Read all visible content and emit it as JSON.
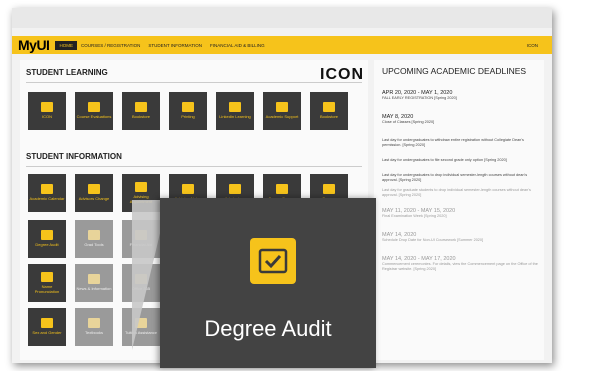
{
  "nav": {
    "logo": "MyUI",
    "items": [
      {
        "label": "HOME",
        "active": true
      },
      {
        "label": "COURSES / REGISTRATION",
        "active": false
      },
      {
        "label": "STUDENT INFORMATION",
        "active": false
      },
      {
        "label": "FINANCIAL AID & BILLING",
        "active": false
      }
    ],
    "right": "ICON",
    "accent": "#f6c31b"
  },
  "learning": {
    "title": "STUDENT LEARNING",
    "brand": "ICON",
    "tiles": [
      {
        "label": "ICON",
        "icon": "list-icon"
      },
      {
        "label": "Course Evaluations",
        "icon": "checkbox-icon"
      },
      {
        "label": "Bookstore",
        "icon": "book-icon"
      },
      {
        "label": "Printing",
        "icon": "printer-icon"
      },
      {
        "label": "Linkedin Learning",
        "icon": "monitor-icon"
      },
      {
        "label": "Academic Support",
        "icon": "building-icon"
      },
      {
        "label": "Bookstore",
        "icon": "book-icon"
      }
    ]
  },
  "info": {
    "title": "STUDENT INFORMATION",
    "row1": [
      {
        "label": "Academic Calendar",
        "icon": "calendar-icon"
      },
      {
        "label": "Advisors Change",
        "icon": "home-icon"
      },
      {
        "label": "Advising Appointment",
        "icon": "clipboard-icon"
      },
      {
        "label": "Advising Notes",
        "icon": "folder-icon"
      },
      {
        "label": "Admissions",
        "icon": "document-icon"
      },
      {
        "label": "Course Browse",
        "icon": "book-icon"
      },
      {
        "label": "Degree",
        "icon": "graduation-icon"
      }
    ],
    "row2": [
      {
        "label": "Degree Audit",
        "icon": "check-icon"
      },
      {
        "label": "Grad Tools",
        "icon": "tools-icon"
      },
      {
        "label": "Financial Aid",
        "icon": "bank-icon"
      }
    ],
    "row3": [
      {
        "label": "Name Pronunciation",
        "icon": "microphone-icon"
      },
      {
        "label": "News & Information",
        "icon": "newspaper-icon"
      },
      {
        "label": "Office 365",
        "icon": "grid-icon"
      }
    ],
    "row4": [
      {
        "label": "Sex and Gender",
        "icon": "person-icon"
      },
      {
        "label": "Textbooks",
        "icon": "book-icon"
      },
      {
        "label": "Tuition Assistance",
        "icon": "chat-icon"
      }
    ]
  },
  "deadlines": {
    "title": "UPCOMING ACADEMIC DEADLINES",
    "events": [
      {
        "date": "APR 20, 2020 - MAY 1, 2020",
        "desc": "FALL EARLY REGISTRATION [Spring 2020]"
      },
      {
        "date": "MAY 8, 2020",
        "desc": "Close of Classes [Spring 2020]"
      },
      {
        "date": "",
        "desc": "Last day for undergraduates to withdraw entire registration without Collegiate Dean's permission. [Spring 2020]"
      },
      {
        "date": "",
        "desc": "Last day for undergraduates to file second grade only option [Spring 2020]"
      },
      {
        "date": "",
        "desc": "Last day for undergraduates to drop individual semester-length courses without dean's approval. [Spring 2020]"
      },
      {
        "date": "",
        "desc": "Last day for graduate students to drop individual semester-length courses without dean's approval. [Spring 2020]"
      },
      {
        "date": "MAY 11, 2020 - MAY 15, 2020",
        "desc": "Final Examination Week [Spring 2020]"
      },
      {
        "date": "MAY 14, 2020",
        "desc": "Schedule Drop Date for Non-UI Coursework [Summer 2020]"
      },
      {
        "date": "MAY 14, 2020 - MAY 17, 2020",
        "desc": "Commencement ceremonies. For details, view the Commencement page on the Office of the Registrar website. [Spring 2020]"
      }
    ]
  },
  "overlay": {
    "label": "Degree Audit",
    "icon": "check-icon"
  }
}
